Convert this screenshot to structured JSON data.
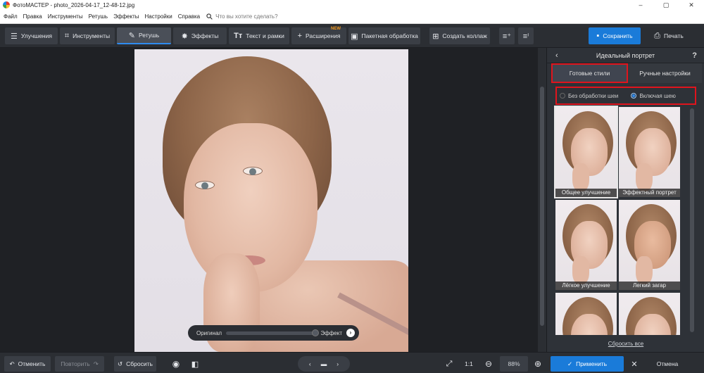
{
  "window": {
    "title": "ФотоМАСТЕР - photo_2026-04-17_12-48-12.jpg",
    "controls": [
      "–",
      "▢",
      "✕"
    ]
  },
  "menu": {
    "items": [
      "Файл",
      "Правка",
      "Инструменты",
      "Ретушь",
      "Эффекты",
      "Настройки",
      "Справка"
    ],
    "search_placeholder": "Что вы хотите сделать?"
  },
  "toolbar": {
    "enhance": "Улучшения",
    "tools": "Инструменты",
    "retouch": "Ретушь",
    "effects": "Эффекты",
    "text": "Текст и рамки",
    "extensions": "Расширения",
    "new_badge": "NEW",
    "batch": "Пакетная обработка",
    "collage": "Создать коллаж",
    "save": "Сохранить",
    "print": "Печать"
  },
  "canvas": {
    "compare_left": "Оригинал",
    "compare_right": "Эффект"
  },
  "panel": {
    "title": "Идеальный портрет",
    "help": "?",
    "tab_presets": "Готовые стили",
    "tab_manual": "Ручные настройки",
    "radio_no_neck": "Без обработки шеи",
    "radio_with_neck": "Включая шею",
    "presets": [
      "Общее улучшение",
      "Эффектный портрет",
      "Лёгкое улучшение",
      "Легкий загар"
    ],
    "reset_all": "Сбросить все"
  },
  "bottom": {
    "undo": "Отменить",
    "redo": "Повторить",
    "reset": "Сбросить",
    "one_to_one": "1:1",
    "zoom": "88%",
    "apply": "Применить",
    "cancel": "Отмена"
  },
  "colors": {
    "accent": "#1a7bd9",
    "highlight": "#e0141d",
    "badge_new": "#f39a1e"
  }
}
